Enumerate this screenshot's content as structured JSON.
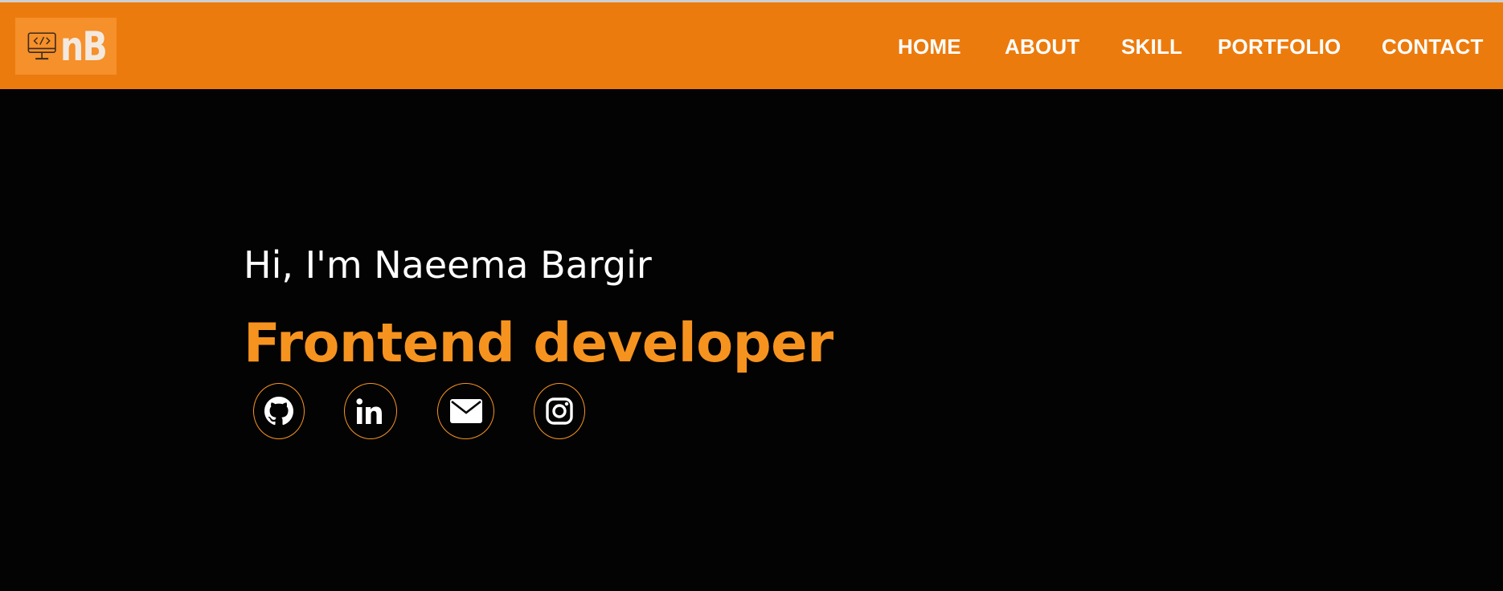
{
  "navbar": {
    "logo": {
      "text": "nB",
      "icon": "code-monitor-icon"
    },
    "links": [
      {
        "label": "HOME"
      },
      {
        "label": "ABOUT"
      },
      {
        "label": "SKILL"
      },
      {
        "label": "PORTFOLIO"
      },
      {
        "label": "CONTACT"
      }
    ]
  },
  "hero": {
    "greeting": "Hi, I'm Naeema Bargir",
    "role": "Frontend developer",
    "social_icons": [
      "github-icon",
      "linkedin-icon",
      "email-icon",
      "instagram-icon"
    ]
  },
  "colors": {
    "nav_background": "#ec7b0d",
    "logo_background": "#f5902a",
    "page_background": "#030303",
    "accent": "#f6931f",
    "text": "#ffffff"
  }
}
